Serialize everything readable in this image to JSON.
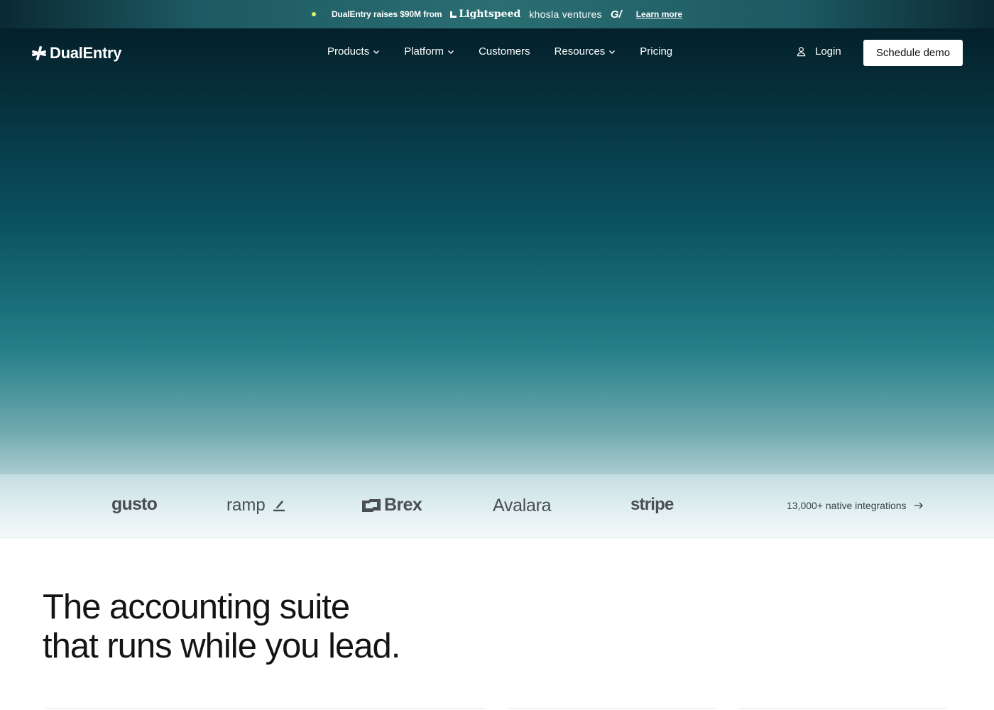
{
  "announcement": {
    "text": "DualEntry raises $90M from",
    "investors": [
      "Lightspeed",
      "khosla ventures",
      "G/"
    ],
    "link_label": "Learn more"
  },
  "nav": {
    "brand": "DualEntry",
    "links": [
      {
        "label": "Products",
        "has_dropdown": true
      },
      {
        "label": "Platform",
        "has_dropdown": true
      },
      {
        "label": "Customers",
        "has_dropdown": false
      },
      {
        "label": "Resources",
        "has_dropdown": true
      },
      {
        "label": "Pricing",
        "has_dropdown": false
      }
    ],
    "login_label": "Login",
    "cta_label": "Schedule demo"
  },
  "partners": {
    "logos": [
      "gusto",
      "ramp",
      "Brex",
      "Avalara",
      "stripe"
    ],
    "integrations_label": "13,000+ native integrations"
  },
  "headline": {
    "line1": "The accounting suite",
    "line2": "that runs while you lead."
  },
  "colors": {
    "hero_top": "#04202a",
    "hero_mid": "#0b5363",
    "hero_bottom": "#a9cccf",
    "announcement_dot": "#d6f56b",
    "cta_bg": "#ffffff"
  }
}
